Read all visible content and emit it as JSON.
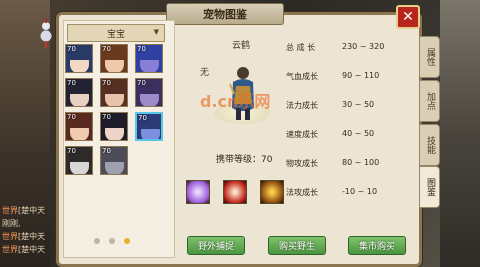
{
  "panel": {
    "title": "宠物图鉴",
    "close_icon": "close-icon"
  },
  "category_select": {
    "value": "宝宝"
  },
  "pets": [
    {
      "level": "70",
      "palette": [
        "#2a3a66",
        "#f2d9c6"
      ]
    },
    {
      "level": "70",
      "palette": [
        "#6b3a1e",
        "#f0c9a8"
      ]
    },
    {
      "level": "70",
      "palette": [
        "#3040a0",
        "#8a7fd6"
      ]
    },
    {
      "level": "70",
      "palette": [
        "#222233",
        "#e9d2c2"
      ]
    },
    {
      "level": "70",
      "palette": [
        "#552f22",
        "#e6c3aa"
      ]
    },
    {
      "level": "70",
      "palette": [
        "#3a2f5e",
        "#9c8acb"
      ]
    },
    {
      "level": "70",
      "palette": [
        "#5a2a20",
        "#f0cbb0"
      ]
    },
    {
      "level": "70",
      "palette": [
        "#1d1d2a",
        "#ecd5c6"
      ]
    },
    {
      "level": "70",
      "palette": [
        "#2b3b78",
        "#7d8fe0"
      ]
    },
    {
      "level": "70",
      "palette": [
        "#2e2a2a",
        "#d8d6d6"
      ]
    },
    {
      "level": "70",
      "palette": [
        "#4d4d5a",
        "#9ea0b0"
      ]
    }
  ],
  "selected_index": 8,
  "pager": {
    "current": 3,
    "total": 3
  },
  "preview": {
    "name": "云鹤",
    "note": "无",
    "watermark": "d.cn乐网",
    "carry_level_label": "携带等级：70"
  },
  "skills": [
    {
      "icon": "swirl-skill-icon",
      "colors": [
        "#9b5bd8",
        "#e8d6ff"
      ]
    },
    {
      "icon": "bird-skill-icon",
      "colors": [
        "#c0241a",
        "#f7e2c8"
      ]
    },
    {
      "icon": "flame-skill-icon",
      "colors": [
        "#8a4a10",
        "#ffcf4a"
      ]
    }
  ],
  "stats": [
    {
      "label": "总 成 长",
      "value": "230 ~ 320"
    },
    {
      "label": "气血成长",
      "value": "90 ~ 110"
    },
    {
      "label": "法力成长",
      "value": "30 ~ 50"
    },
    {
      "label": "速度成长",
      "value": "40 ~ 50"
    },
    {
      "label": "物攻成长",
      "value": "80 ~ 100"
    },
    {
      "label": "法攻成长",
      "value": "-10 ~ 10"
    }
  ],
  "tabs": [
    {
      "label": "属性",
      "active": false
    },
    {
      "label": "加点",
      "active": false
    },
    {
      "label": "技能",
      "active": false
    },
    {
      "label": "图鉴",
      "active": true
    }
  ],
  "buttons": {
    "capture": "野外捕捉",
    "buy_wild": "购买野生",
    "market": "集市购买"
  },
  "chat": [
    {
      "tag": "世界",
      "text": "[楚中天"
    },
    {
      "tag": "",
      "text": "刚刚,"
    },
    {
      "tag": "世界",
      "text": "[楚中天"
    },
    {
      "tag": "世界",
      "text": "[楚中天"
    }
  ],
  "colors": {
    "accent": "#8a7452",
    "close": "#b7261e",
    "button": "#4c9440",
    "selected": "#59c6e8"
  }
}
